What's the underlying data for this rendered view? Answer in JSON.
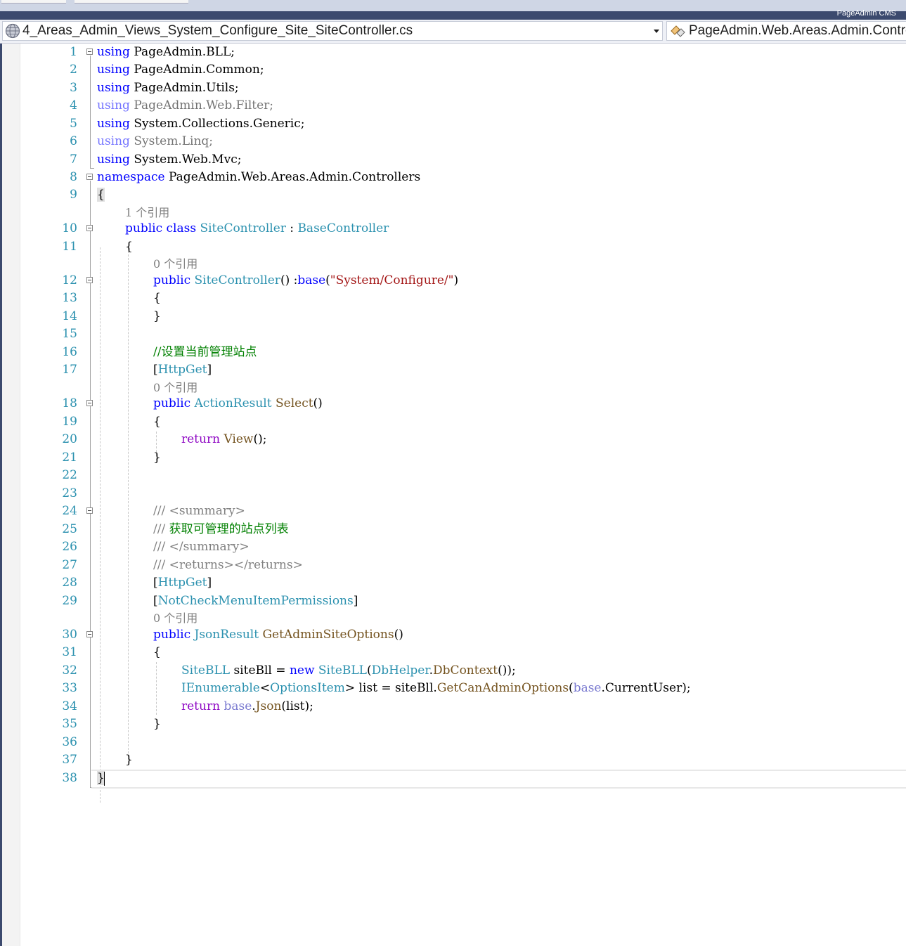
{
  "window": {
    "brand": "PageAdmin CMS"
  },
  "nav": {
    "file_combo": "4_Areas_Admin_Views_System_Configure_Site_SiteController.cs",
    "namespace_combo": "PageAdmin.Web.Areas.Admin.Controllers"
  },
  "colors": {
    "keyword": "#0000ff",
    "type": "#2b91af",
    "method": "#74531f",
    "string": "#a31515",
    "comment": "#008000",
    "codelens": "#808080",
    "line_number": "#2b91af"
  },
  "codelens": {
    "ref1": "1 个引用",
    "ref0": "0 个引用"
  },
  "lines": {
    "1": "1",
    "2": "2",
    "3": "3",
    "4": "4",
    "5": "5",
    "6": "6",
    "7": "7",
    "8": "8",
    "9": "9",
    "10": "10",
    "11": "11",
    "12": "12",
    "13": "13",
    "14": "14",
    "15": "15",
    "16": "16",
    "17": "17",
    "18": "18",
    "19": "19",
    "20": "20",
    "21": "21",
    "22": "22",
    "23": "23",
    "24": "24",
    "25": "25",
    "26": "26",
    "27": "27",
    "28": "28",
    "29": "29",
    "30": "30",
    "31": "31",
    "32": "32",
    "33": "33",
    "34": "34",
    "35": "35",
    "36": "36",
    "37": "37",
    "38": "38"
  },
  "tok": {
    "using": "using",
    "ns_bll": " PageAdmin.BLL;",
    "ns_common": " PageAdmin.Common;",
    "ns_utils": " PageAdmin.Utils;",
    "ns_filter": " PageAdmin.Web.Filter;",
    "ns_generic": " System.Collections.Generic;",
    "ns_linq": " System.Linq;",
    "ns_mvc": " System.Web.Mvc;",
    "namespace": "namespace",
    "ns_name": " PageAdmin.Web.Areas.Admin.Controllers",
    "open": "{",
    "close": "}",
    "public": "public",
    "class": "class",
    "site_controller": "SiteController",
    "colon": " : ",
    "base_controller": "BaseController",
    "ctor_sig_mid": "() :",
    "base": "base",
    "paren_open": "(",
    "ctor_str": "\"System/Configure/\"",
    "paren_close": ")",
    "comment_set_site": "//设置当前管理站点",
    "lbr": "[",
    "rbr": "]",
    "http_get": "HttpGet",
    "action_result": "ActionResult",
    "select": "Select",
    "parens": "()",
    "return": "return",
    "view": "View",
    "call_end": "();",
    "doc_slash": "///",
    "summary_open": " <summary>",
    "summary_text": " 获取可管理的站点列表",
    "summary_close": " </summary>",
    "returns_tag": " <returns></returns>",
    "not_check": "NotCheckMenuItemPermissions",
    "json_result": "JsonResult",
    "get_options": "GetAdminSiteOptions",
    "site_bll": "SiteBLL",
    "sitebll_var": " siteBll = ",
    "new": "new",
    "db_helper": "DbHelper",
    "dot": ".",
    "db_context": "DbContext",
    "ctx_end": "());",
    "ienumerable": "IEnumerable",
    "lt": "<",
    "options_item": "OptionsItem",
    "gt": ">",
    "list_assign": " list = siteBll.",
    "get_can_admin": "GetCanAdminOptions",
    "current_user_end": "CurrentUser);",
    "json": "Json",
    "list_end": "(list);"
  }
}
